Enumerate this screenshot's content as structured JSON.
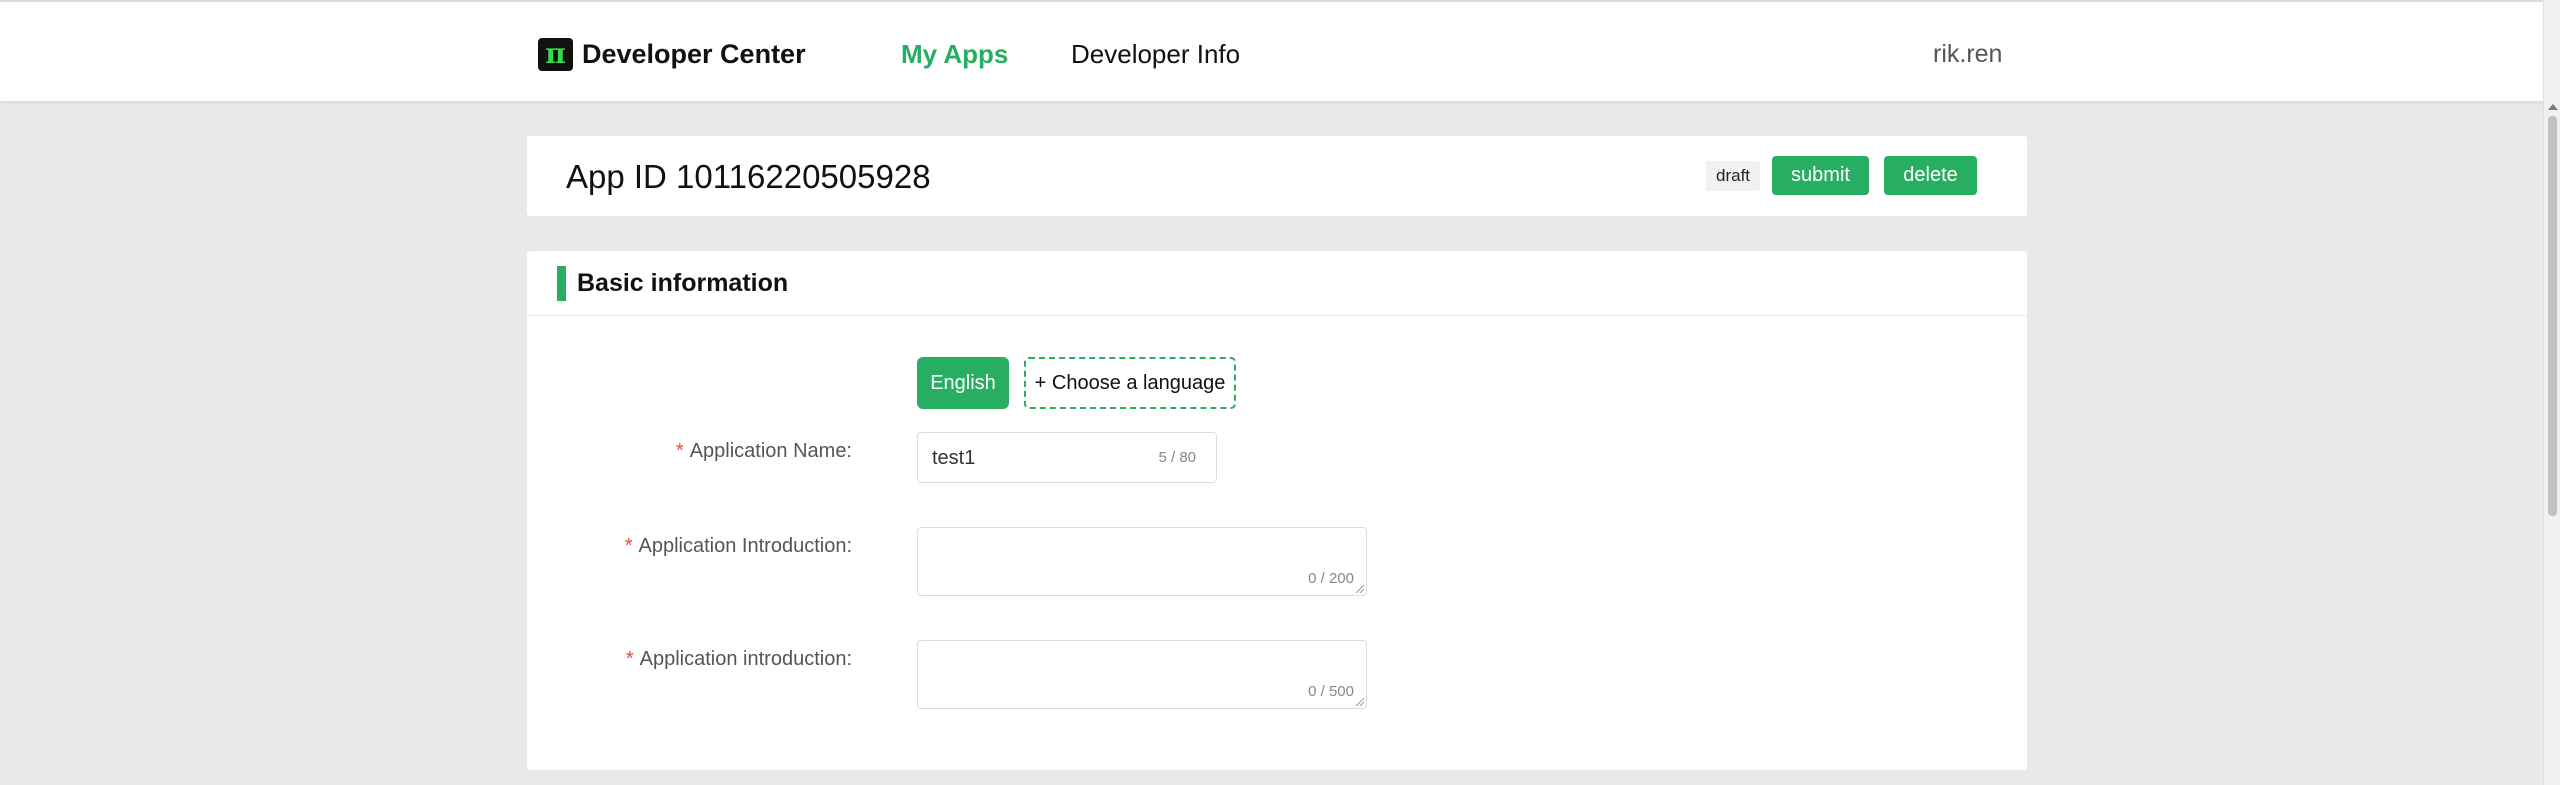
{
  "header": {
    "logo_glyph": "π",
    "brand": "Developer Center",
    "nav": [
      {
        "label": "My Apps",
        "active": true
      },
      {
        "label": "Developer Info",
        "active": false
      }
    ],
    "user": "rik.ren"
  },
  "app": {
    "title": "App ID 10116220505928",
    "status": "draft",
    "submit_label": "submit",
    "delete_label": "delete"
  },
  "basic": {
    "title": "Basic information",
    "languages": {
      "current": "English",
      "add_label": "+ Choose a language"
    },
    "fields": {
      "name": {
        "label": "Application Name:",
        "value": "test1",
        "count": "5 / 80"
      },
      "intro_short": {
        "label": "Application Introduction:",
        "value": "",
        "count": "0 / 200"
      },
      "intro_long": {
        "label": "Application introduction:",
        "value": "",
        "count": "0 / 500"
      }
    },
    "required_mark": "*"
  },
  "colors": {
    "accent": "#27ae60",
    "required": "#e74c3c",
    "page_bg": "#e9e9e9",
    "logo_bg": "#111111",
    "logo_glyph": "#39d84b"
  }
}
